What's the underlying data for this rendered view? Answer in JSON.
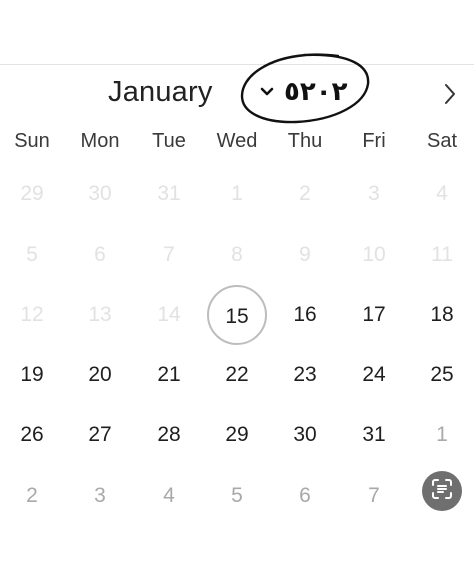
{
  "header": {
    "month": "January",
    "year": "٢٠٢٥"
  },
  "icons": {
    "year_dropdown": "chevron-down-icon",
    "next_month": "chevron-right-icon",
    "scan": "text-scan-icon"
  },
  "colors": {
    "today_ring": "#bdbdbd",
    "scan_button_bg": "#6f6f6f"
  },
  "weekdays": [
    "Sun",
    "Mon",
    "Tue",
    "Wed",
    "Thu",
    "Fri",
    "Sat"
  ],
  "weeks": [
    [
      {
        "label": "29",
        "state": "disabled"
      },
      {
        "label": "30",
        "state": "disabled"
      },
      {
        "label": "31",
        "state": "disabled"
      },
      {
        "label": "1",
        "state": "disabled"
      },
      {
        "label": "2",
        "state": "disabled"
      },
      {
        "label": "3",
        "state": "disabled"
      },
      {
        "label": "4",
        "state": "disabled"
      }
    ],
    [
      {
        "label": "5",
        "state": "disabled"
      },
      {
        "label": "6",
        "state": "disabled"
      },
      {
        "label": "7",
        "state": "disabled"
      },
      {
        "label": "8",
        "state": "disabled"
      },
      {
        "label": "9",
        "state": "disabled"
      },
      {
        "label": "10",
        "state": "disabled"
      },
      {
        "label": "11",
        "state": "disabled"
      }
    ],
    [
      {
        "label": "12",
        "state": "disabled"
      },
      {
        "label": "13",
        "state": "disabled"
      },
      {
        "label": "14",
        "state": "disabled"
      },
      {
        "label": "15",
        "state": "today"
      },
      {
        "label": "16",
        "state": "active"
      },
      {
        "label": "17",
        "state": "active"
      },
      {
        "label": "18",
        "state": "active"
      }
    ],
    [
      {
        "label": "19",
        "state": "active"
      },
      {
        "label": "20",
        "state": "active"
      },
      {
        "label": "21",
        "state": "active"
      },
      {
        "label": "22",
        "state": "active"
      },
      {
        "label": "23",
        "state": "active"
      },
      {
        "label": "24",
        "state": "active"
      },
      {
        "label": "25",
        "state": "active"
      }
    ],
    [
      {
        "label": "26",
        "state": "active"
      },
      {
        "label": "27",
        "state": "active"
      },
      {
        "label": "28",
        "state": "active"
      },
      {
        "label": "29",
        "state": "active"
      },
      {
        "label": "30",
        "state": "active"
      },
      {
        "label": "31",
        "state": "active"
      },
      {
        "label": "1",
        "state": "outside"
      }
    ],
    [
      {
        "label": "2",
        "state": "outside"
      },
      {
        "label": "3",
        "state": "outside"
      },
      {
        "label": "4",
        "state": "outside"
      },
      {
        "label": "5",
        "state": "outside"
      },
      {
        "label": "6",
        "state": "outside"
      },
      {
        "label": "7",
        "state": "outside"
      },
      {
        "label": "",
        "state": "empty"
      }
    ]
  ]
}
